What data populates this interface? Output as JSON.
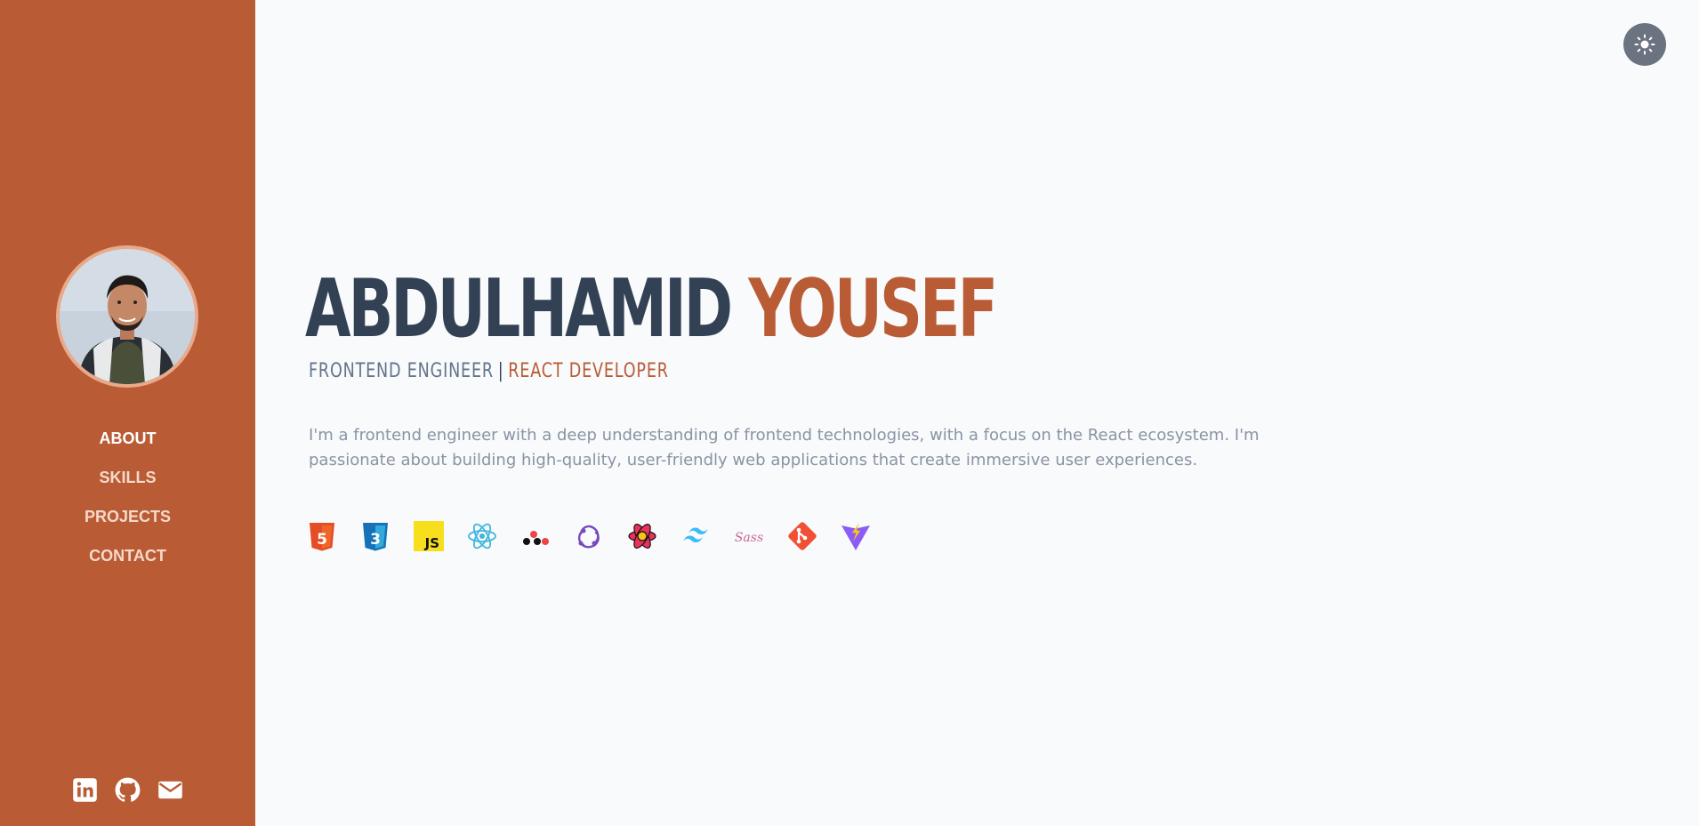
{
  "sidebar": {
    "accent_color": "#b95c35",
    "avatar_alt": "Profile photo",
    "nav": [
      {
        "label": "ABOUT",
        "active": true
      },
      {
        "label": "SKILLS",
        "active": false
      },
      {
        "label": "PROJECTS",
        "active": false
      },
      {
        "label": "CONTACT",
        "active": false
      }
    ],
    "social": [
      {
        "icon": "linkedin-icon"
      },
      {
        "icon": "github-icon"
      },
      {
        "icon": "envelope-icon"
      }
    ]
  },
  "header": {
    "theme_toggle_icon": "sun-icon"
  },
  "hero": {
    "first_name": "ABDULHAMID",
    "last_name": "YOUSEF",
    "role_primary": "FRONTEND ENGINEER",
    "separator": "|",
    "role_secondary": "REACT DEVELOPER",
    "bio": "I'm a frontend engineer with a deep understanding of frontend technologies, with a focus on the React ecosystem. I'm passionate about building high-quality, user-friendly web applications that create immersive user experiences."
  },
  "tech_stack": [
    {
      "icon": "html5-icon",
      "text": "5"
    },
    {
      "icon": "css3-icon",
      "text": "3"
    },
    {
      "icon": "javascript-icon",
      "text": "JS"
    },
    {
      "icon": "react-icon"
    },
    {
      "icon": "react-query-icon"
    },
    {
      "icon": "redux-icon"
    },
    {
      "icon": "react-router-icon"
    },
    {
      "icon": "tailwind-icon"
    },
    {
      "icon": "sass-icon",
      "text": "Sass"
    },
    {
      "icon": "git-icon"
    },
    {
      "icon": "vite-icon"
    }
  ]
}
